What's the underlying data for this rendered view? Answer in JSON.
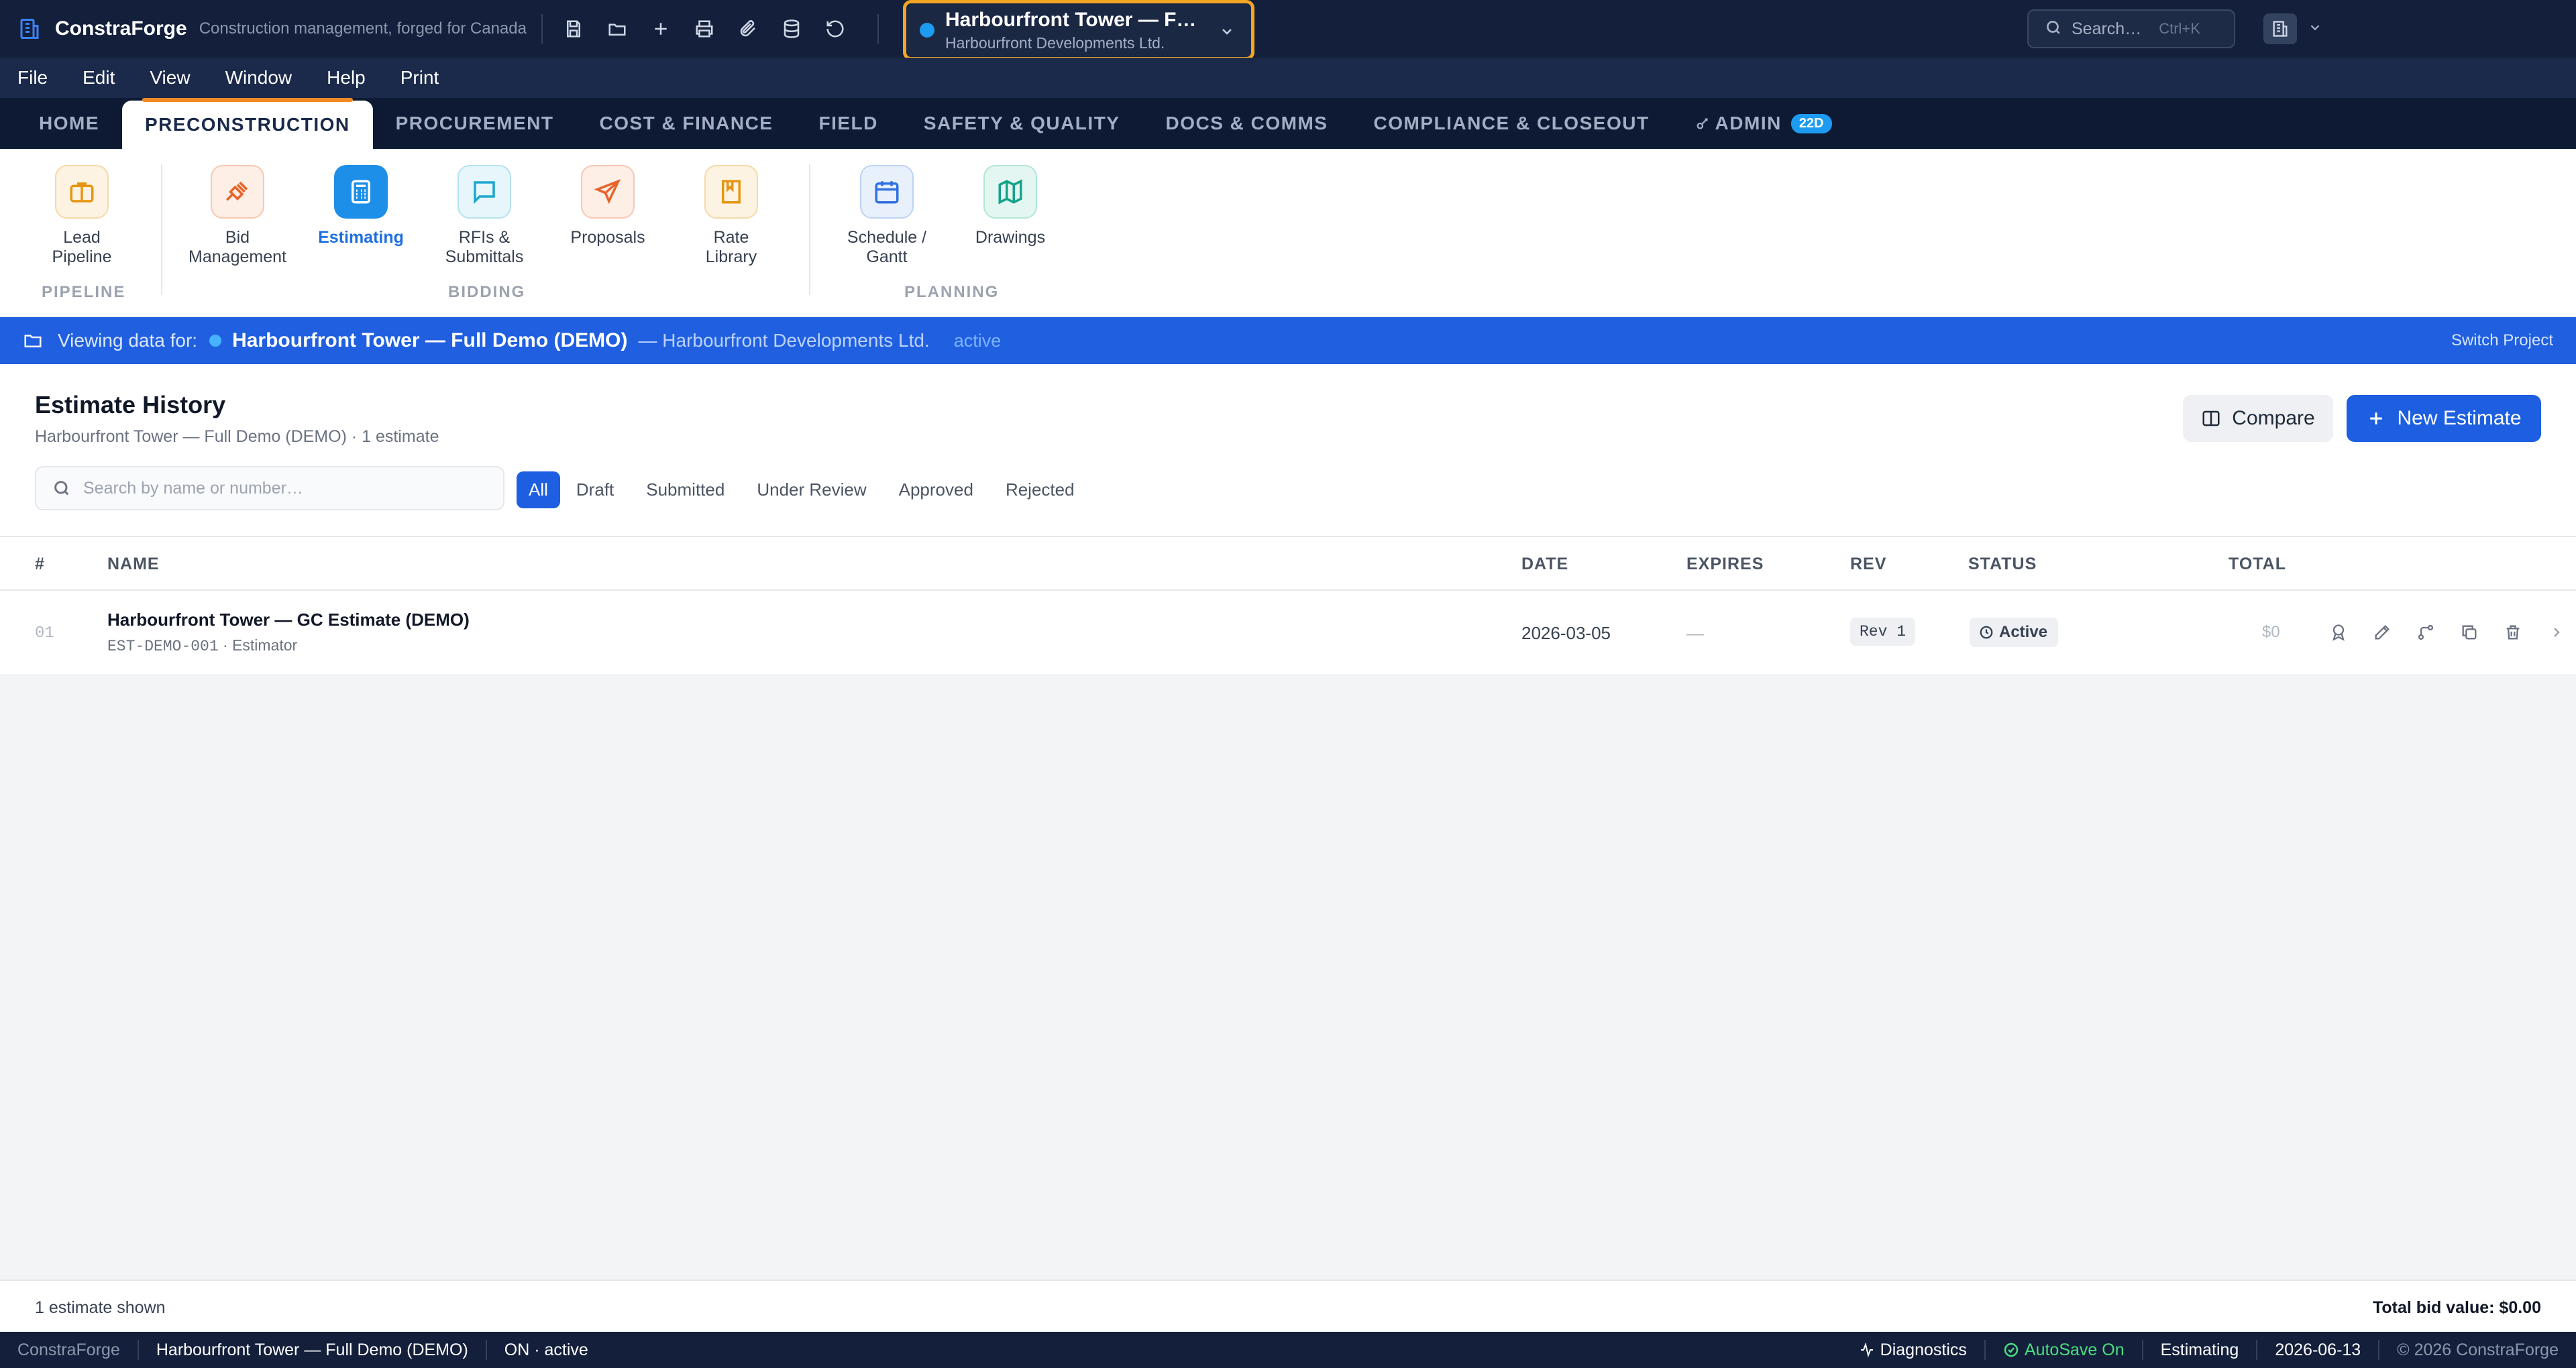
{
  "app": {
    "name": "ConstraForge",
    "tagline": "Construction management, forged for Canada"
  },
  "project_selector": {
    "title": "Harbourfront Tower — F…",
    "subtitle": "Harbourfront Developments Ltd."
  },
  "search": {
    "placeholder": "Search…",
    "shortcut": "Ctrl+K"
  },
  "menu": [
    "File",
    "Edit",
    "View",
    "Window",
    "Help",
    "Print"
  ],
  "tabs": [
    {
      "label": "HOME"
    },
    {
      "label": "PRECONSTRUCTION",
      "active": true
    },
    {
      "label": "PROCUREMENT"
    },
    {
      "label": "COST & FINANCE"
    },
    {
      "label": "FIELD"
    },
    {
      "label": "SAFETY & QUALITY"
    },
    {
      "label": "DOCS & COMMS"
    },
    {
      "label": "COMPLIANCE & CLOSEOUT"
    },
    {
      "label": "ADMIN",
      "badge": "22D"
    }
  ],
  "ribbon": {
    "items": [
      {
        "label": "Lead Pipeline",
        "icon": "briefcase-icon"
      },
      {
        "label": "Bid Management",
        "icon": "gavel-icon"
      },
      {
        "label": "Estimating",
        "icon": "calculator-icon",
        "active": true
      },
      {
        "label": "RFIs & Submittals",
        "icon": "message-icon"
      },
      {
        "label": "Proposals",
        "icon": "send-icon"
      },
      {
        "label": "Rate Library",
        "icon": "book-icon"
      },
      {
        "label": "Schedule / Gantt",
        "icon": "calendar-icon"
      },
      {
        "label": "Drawings",
        "icon": "map-icon"
      }
    ],
    "groups": [
      "PIPELINE",
      "BIDDING",
      "PLANNING"
    ]
  },
  "viewing": {
    "label": "Viewing data for:",
    "project": "Harbourfront Tower — Full Demo (DEMO)",
    "owner": "— Harbourfront Developments Ltd.",
    "status": "active",
    "switch": "Switch Project"
  },
  "estimates": {
    "title": "Estimate History",
    "subtitle": "Harbourfront Tower — Full Demo (DEMO) · 1 estimate",
    "compare_label": "Compare",
    "new_label": "New Estimate",
    "search_placeholder": "Search by name or number…",
    "filters": [
      "All",
      "Draft",
      "Submitted",
      "Under Review",
      "Approved",
      "Rejected"
    ],
    "active_filter": "All",
    "columns": [
      "#",
      "NAME",
      "DATE",
      "EXPIRES",
      "REV",
      "STATUS",
      "TOTAL"
    ],
    "rows": [
      {
        "num": "01",
        "name": "Harbourfront Tower — GC Estimate (DEMO)",
        "code": "EST-DEMO-001",
        "role": "· Estimator",
        "date": "2026-03-05",
        "expires": "—",
        "rev": "Rev 1",
        "status": "Active",
        "total": "$0"
      }
    ]
  },
  "summary": {
    "shown": "1 estimate shown",
    "total": "Total bid value: $0.00"
  },
  "statusbar": {
    "app": "ConstraForge",
    "project": "Harbourfront Tower — Full Demo (DEMO)",
    "state": "ON · active",
    "diagnostics": "Diagnostics",
    "autosave": "AutoSave On",
    "module": "Estimating",
    "date": "2026-06-13",
    "copyright": "© 2026 ConstraForge"
  },
  "colors": {
    "topbar": "#14203b",
    "accent": "#1d5fe0",
    "selector_border": "#f5a524",
    "autosave": "#4ade80"
  }
}
